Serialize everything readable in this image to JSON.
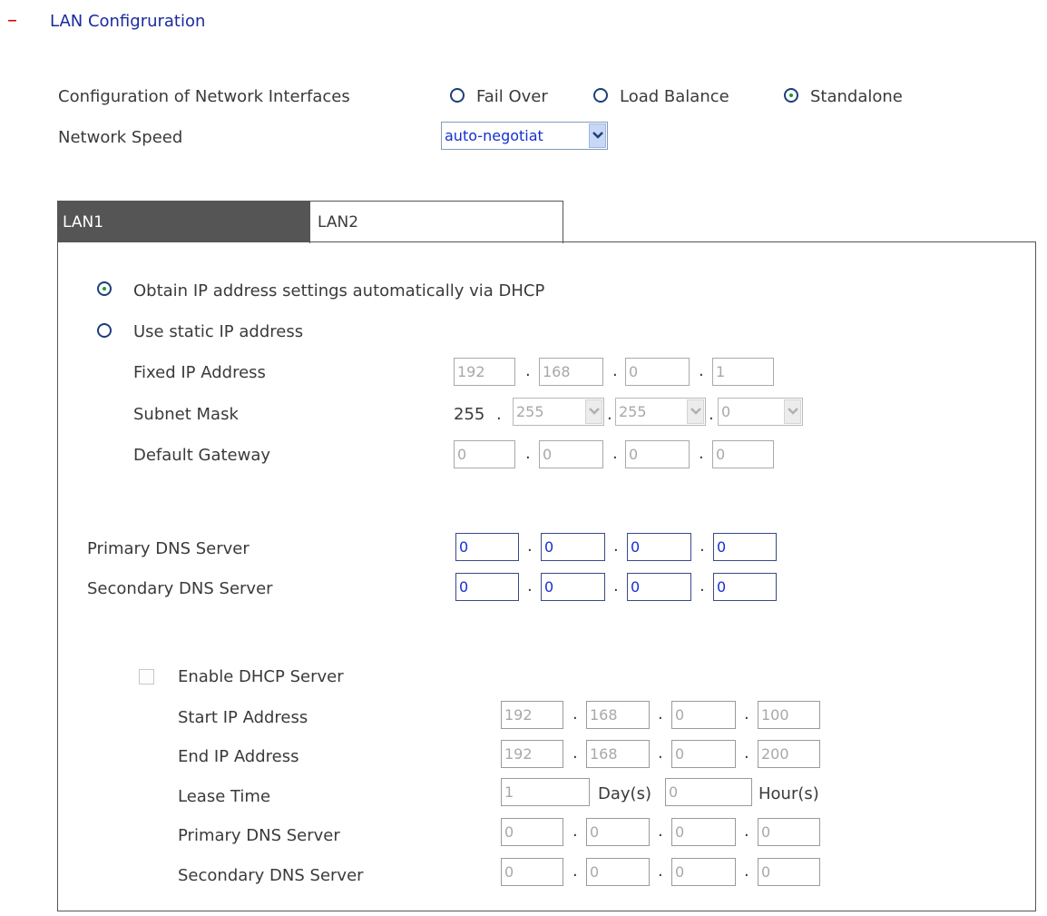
{
  "section": {
    "title": "LAN Configruration",
    "collapse_symbol": "–"
  },
  "config": {
    "label": "Configuration of Network Interfaces",
    "options": [
      "Fail Over",
      "Load Balance",
      "Standalone"
    ],
    "selected": "Standalone"
  },
  "speed": {
    "label": "Network Speed",
    "value": "auto-negotiat"
  },
  "tabs": [
    "LAN1",
    "LAN2"
  ],
  "ip_mode": {
    "dhcp_label": "Obtain IP address settings automatically via DHCP",
    "static_label": "Use static IP address",
    "selected": "dhcp"
  },
  "static": {
    "fixed_ip": {
      "label": "Fixed IP Address",
      "values": [
        "192",
        "168",
        "0",
        "1"
      ]
    },
    "subnet": {
      "label": "Subnet Mask",
      "prefix": "255",
      "values": [
        "255",
        "255",
        "0"
      ]
    },
    "gateway": {
      "label": "Default Gateway",
      "values": [
        "0",
        "0",
        "0",
        "0"
      ]
    }
  },
  "dns": {
    "primary": {
      "label": "Primary DNS Server",
      "values": [
        "0",
        "0",
        "0",
        "0"
      ]
    },
    "secondary": {
      "label": "Secondary DNS Server",
      "values": [
        "0",
        "0",
        "0",
        "0"
      ]
    }
  },
  "dhcp_server": {
    "enable_label": "Enable DHCP Server",
    "enabled": false,
    "start_ip": {
      "label": "Start IP Address",
      "values": [
        "192",
        "168",
        "0",
        "100"
      ]
    },
    "end_ip": {
      "label": "End IP Address",
      "values": [
        "192",
        "168",
        "0",
        "200"
      ]
    },
    "lease": {
      "label": "Lease Time",
      "days": "1",
      "days_unit": "Day(s)",
      "hours": "0",
      "hours_unit": "Hour(s)"
    },
    "primary_dns": {
      "label": "Primary DNS Server",
      "values": [
        "0",
        "0",
        "0",
        "0"
      ]
    },
    "secondary_dns": {
      "label": "Secondary DNS Server",
      "values": [
        "0",
        "0",
        "0",
        "0"
      ]
    }
  },
  "separator": "."
}
